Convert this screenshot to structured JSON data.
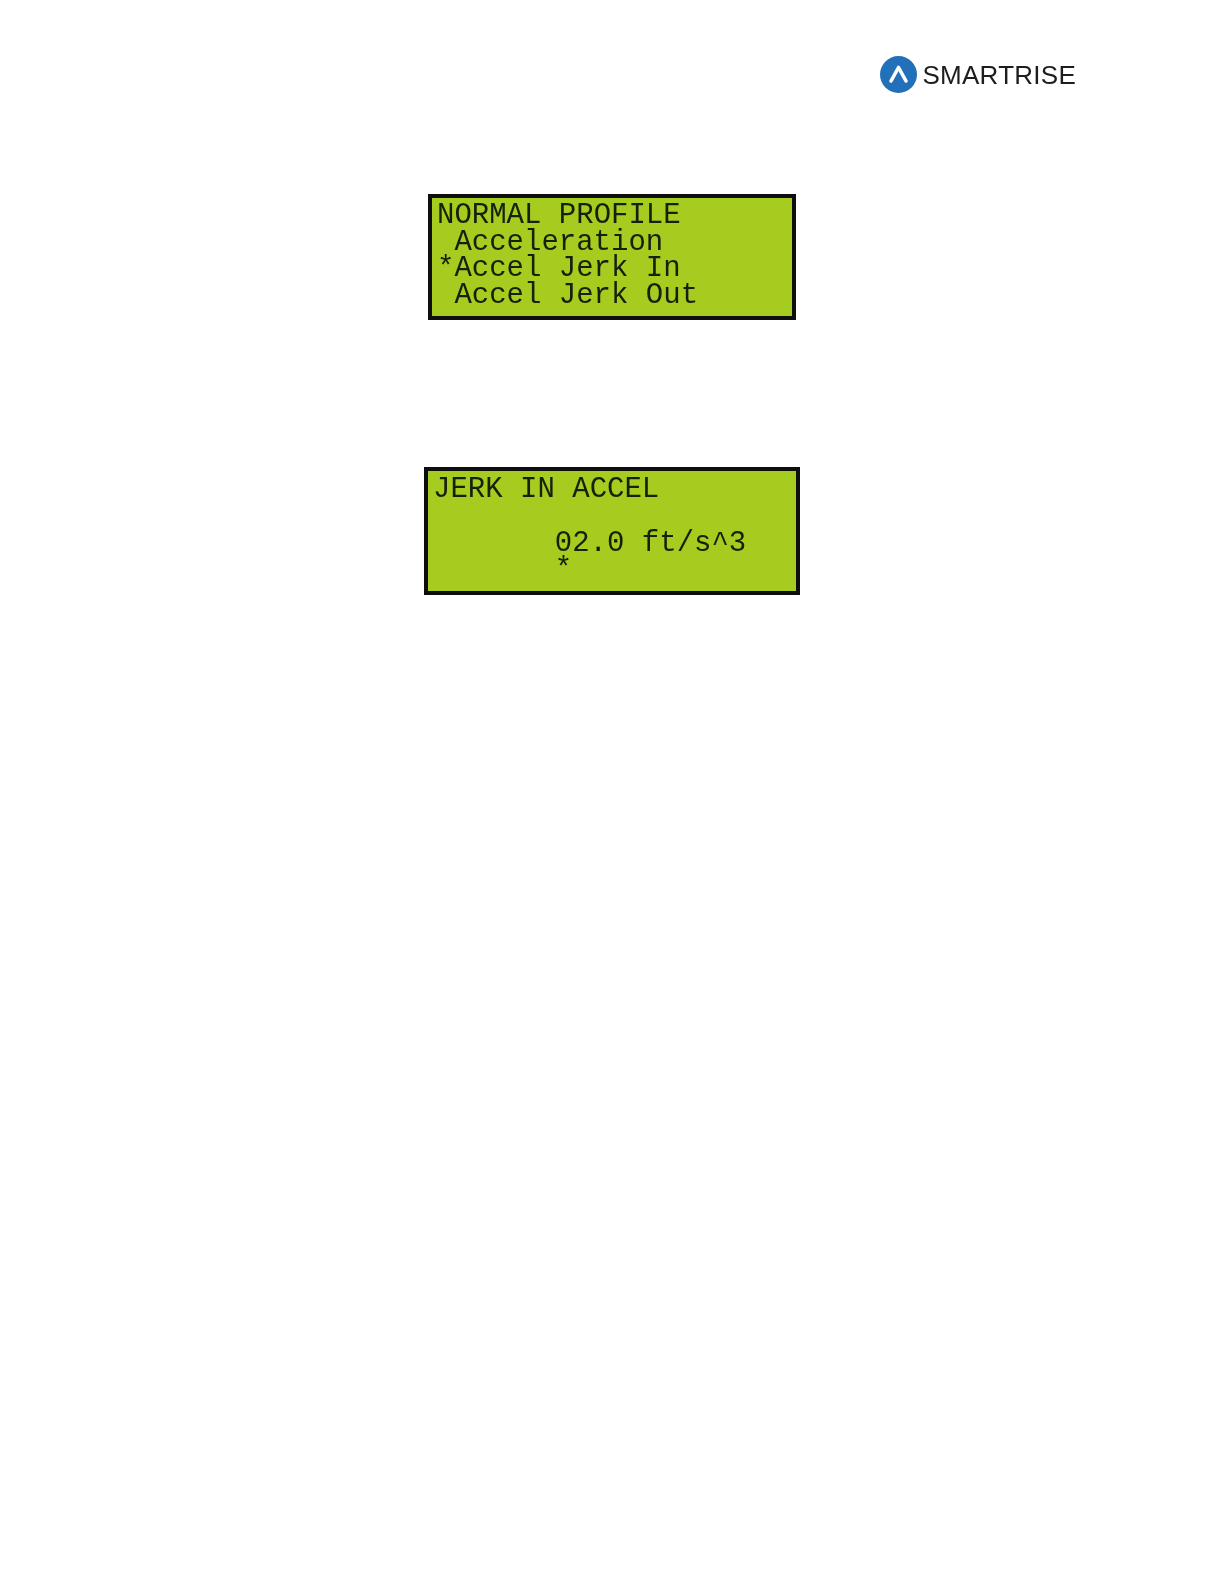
{
  "logo": {
    "text": "SMARTRISE"
  },
  "screens": [
    {
      "kind": "menu",
      "title": "NORMAL PROFILE",
      "items": [
        {
          "label": "Acceleration"
        },
        {
          "cursor": "*",
          "label": "Accel Jerk In"
        },
        {
          "label": "Accel Jerk Out"
        }
      ]
    },
    {
      "kind": "edit",
      "title": "JERK IN ACCEL",
      "value": "02.0 ft/s^3",
      "cursor": "*"
    }
  ]
}
